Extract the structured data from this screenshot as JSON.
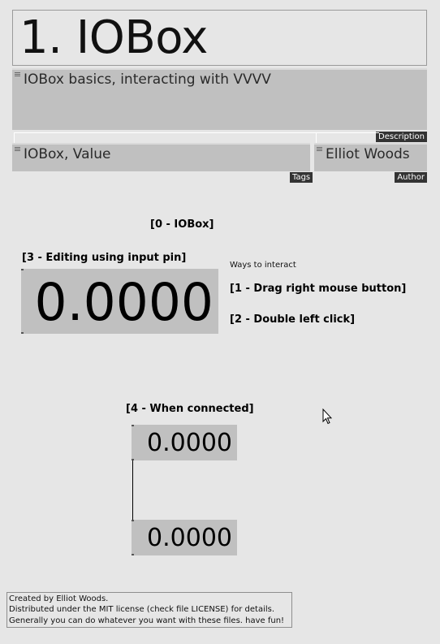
{
  "title": "1. IOBox",
  "description": {
    "text": "IOBox basics, interacting with VVVV",
    "tag": "Description"
  },
  "tags": {
    "text": "IOBox, Value",
    "tag": "Tags"
  },
  "author": {
    "text": "Elliot Woods",
    "tag": "Author"
  },
  "labels": {
    "iobox": "[0 - IOBox]",
    "editing": "[3 - Editing using input pin]",
    "ways": "Ways to interact",
    "drag": "[1 - Drag right mouse button]",
    "double_click": "[2 - Double left click]",
    "connected": "[4 - When connected]"
  },
  "values": {
    "big": "0.0000",
    "connected_top": "0.0000",
    "connected_bottom": "0.0000"
  },
  "footer": {
    "line1": "Created by Elliot Woods.",
    "line2": "Distributed under the MIT license (check file LICENSE) for details.",
    "line3": "Generally you can do whatever you want with these files. have fun!"
  }
}
